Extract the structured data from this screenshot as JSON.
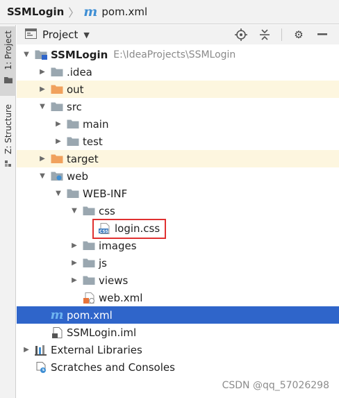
{
  "breadcrumb": {
    "root": "SSMLogin",
    "file": "pom.xml"
  },
  "strip": {
    "project_tab": "1: Project",
    "structure_tab": "Z: Structure"
  },
  "panel": {
    "title": "Project"
  },
  "tree": [
    {
      "label": "SSMLogin",
      "path": "E:\\IdeaProjects\\SSMLogin",
      "bold": true,
      "indent": 0,
      "arrow": "down",
      "icon": "folder-module"
    },
    {
      "label": ".idea",
      "indent": 1,
      "arrow": "right",
      "icon": "folder"
    },
    {
      "label": "out",
      "indent": 1,
      "arrow": "right",
      "icon": "folder-orange",
      "excluded": true
    },
    {
      "label": "src",
      "indent": 1,
      "arrow": "down",
      "icon": "folder"
    },
    {
      "label": "main",
      "indent": 2,
      "arrow": "right",
      "icon": "folder"
    },
    {
      "label": "test",
      "indent": 2,
      "arrow": "right",
      "icon": "folder"
    },
    {
      "label": "target",
      "indent": 1,
      "arrow": "right",
      "icon": "folder-orange",
      "excluded": true
    },
    {
      "label": "web",
      "indent": 1,
      "arrow": "down",
      "icon": "folder-web"
    },
    {
      "label": "WEB-INF",
      "indent": 2,
      "arrow": "down",
      "icon": "folder"
    },
    {
      "label": "css",
      "indent": 3,
      "arrow": "down",
      "icon": "folder"
    },
    {
      "label": "login.css",
      "indent": 4,
      "arrow": "none",
      "icon": "css-file"
    },
    {
      "label": "images",
      "indent": 3,
      "arrow": "right",
      "icon": "folder"
    },
    {
      "label": "js",
      "indent": 3,
      "arrow": "right",
      "icon": "folder"
    },
    {
      "label": "views",
      "indent": 3,
      "arrow": "right",
      "icon": "folder"
    },
    {
      "label": "web.xml",
      "indent": 3,
      "arrow": "none",
      "icon": "xml-file"
    },
    {
      "label": "pom.xml",
      "indent": 1,
      "arrow": "none",
      "icon": "maven-file",
      "selected": true
    },
    {
      "label": "SSMLogin.iml",
      "indent": 1,
      "arrow": "none",
      "icon": "iml-file"
    },
    {
      "label": "External Libraries",
      "indent": 0,
      "arrow": "right",
      "icon": "libraries"
    },
    {
      "label": "Scratches and Consoles",
      "indent": 0,
      "arrow": "none",
      "icon": "scratches"
    }
  ],
  "watermark": "CSDN @qq_57026298",
  "colors": {
    "selection": "#2f65ca",
    "excluded_bg": "#fdf6df",
    "folder": "#9aa7b0",
    "excluded_folder": "#f0a15d",
    "highlight": "#e03030"
  }
}
